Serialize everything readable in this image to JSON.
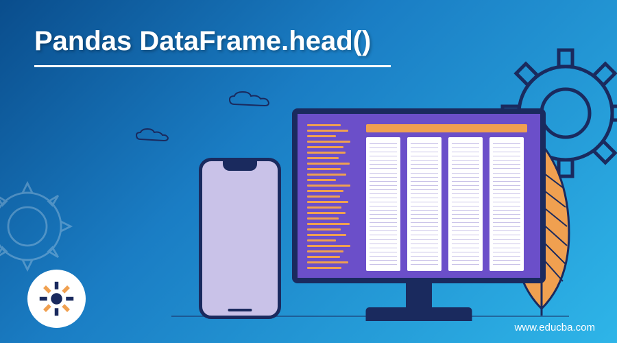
{
  "title": "Pandas DataFrame.head()",
  "watermark": "www.educba.com",
  "colors": {
    "bg_start": "#0a4d8c",
    "bg_end": "#2eb5e8",
    "accent_orange": "#f0a050",
    "purple": "#6b4fc9",
    "dark_navy": "#1a2a5e",
    "light_purple": "#c9c2e8"
  }
}
